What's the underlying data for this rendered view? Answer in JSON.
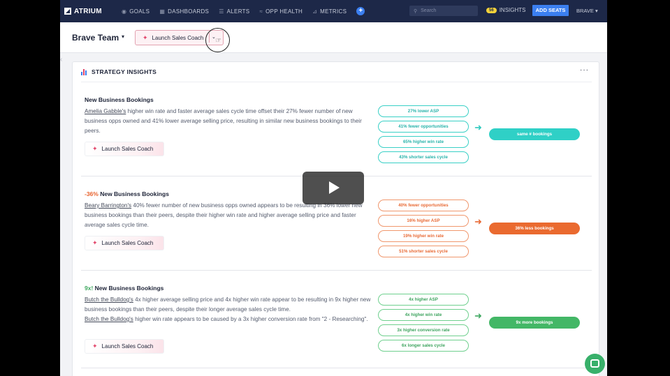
{
  "nav": {
    "brand": "ATRIUM",
    "items": [
      {
        "icon": "goals-icon",
        "label": "GOALS"
      },
      {
        "icon": "dashboards-icon",
        "label": "DASHBOARDS"
      },
      {
        "icon": "alerts-icon",
        "label": "ALERTS"
      },
      {
        "icon": "opp-health-icon",
        "label": "OPP HEALTH"
      },
      {
        "icon": "metrics-icon",
        "label": "METRICS"
      }
    ],
    "search_placeholder": "Search",
    "insights_count": "56",
    "insights_label": "INSIGHTS",
    "add_seats": "ADD SEATS",
    "user": "BRAVE"
  },
  "header": {
    "team": "Brave Team",
    "coach_button": "Launch Sales Coach"
  },
  "card": {
    "title": "STRATEGY INSIGHTS",
    "insights": [
      {
        "title_prefix": "",
        "title": "New Business Bookings",
        "name1": "Amelia Gabble's",
        "body1": " higher win rate and faster average sales cycle time offset their 27% fewer number of new business opps owned and 41% lower average selling price, resulting in similar new business bookings to their peers.",
        "name2": "",
        "body2": "",
        "button": "Launch Sales Coach",
        "factors": [
          "27% lower ASP",
          "41% fewer opportunities",
          "65% higher win rate",
          "43% shorter sales cycle"
        ],
        "result": "same # bookings",
        "color": "teal"
      },
      {
        "title_prefix": "-36%",
        "title": " New Business Bookings",
        "name1": "Beary Barrington's",
        "body1": " 40% fewer number of new business opps owned appears to be resulting in 36% lower new business bookings than their peers, despite their higher win rate and higher average selling price and faster average sales cycle time.",
        "name2": "",
        "body2": "",
        "button": "Launch Sales Coach",
        "factors": [
          "40% fewer opportunities",
          "16% higher ASP",
          "19% higher win rate",
          "51% shorter sales cycle"
        ],
        "result": "36% less bookings",
        "color": "orange"
      },
      {
        "title_prefix": "9x!",
        "title": " New Business Bookings",
        "name1": "Butch the Bulldog's",
        "body1": " 4x higher average selling price and 4x higher win rate appear to be resulting in 9x higher new business bookings than their peers, despite their longer average sales cycle time.",
        "name2": "Butch the Bulldog's",
        "body2": " higher win rate appears to be caused by a 3x higher conversion rate from \"2 - Researching\".",
        "button": "Launch Sales Coach",
        "factors": [
          "4x higher ASP",
          "4x higher win rate",
          "3x higher conversion rate",
          "6x longer sales cycle"
        ],
        "result": "9x more bookings",
        "color": "green"
      }
    ]
  }
}
